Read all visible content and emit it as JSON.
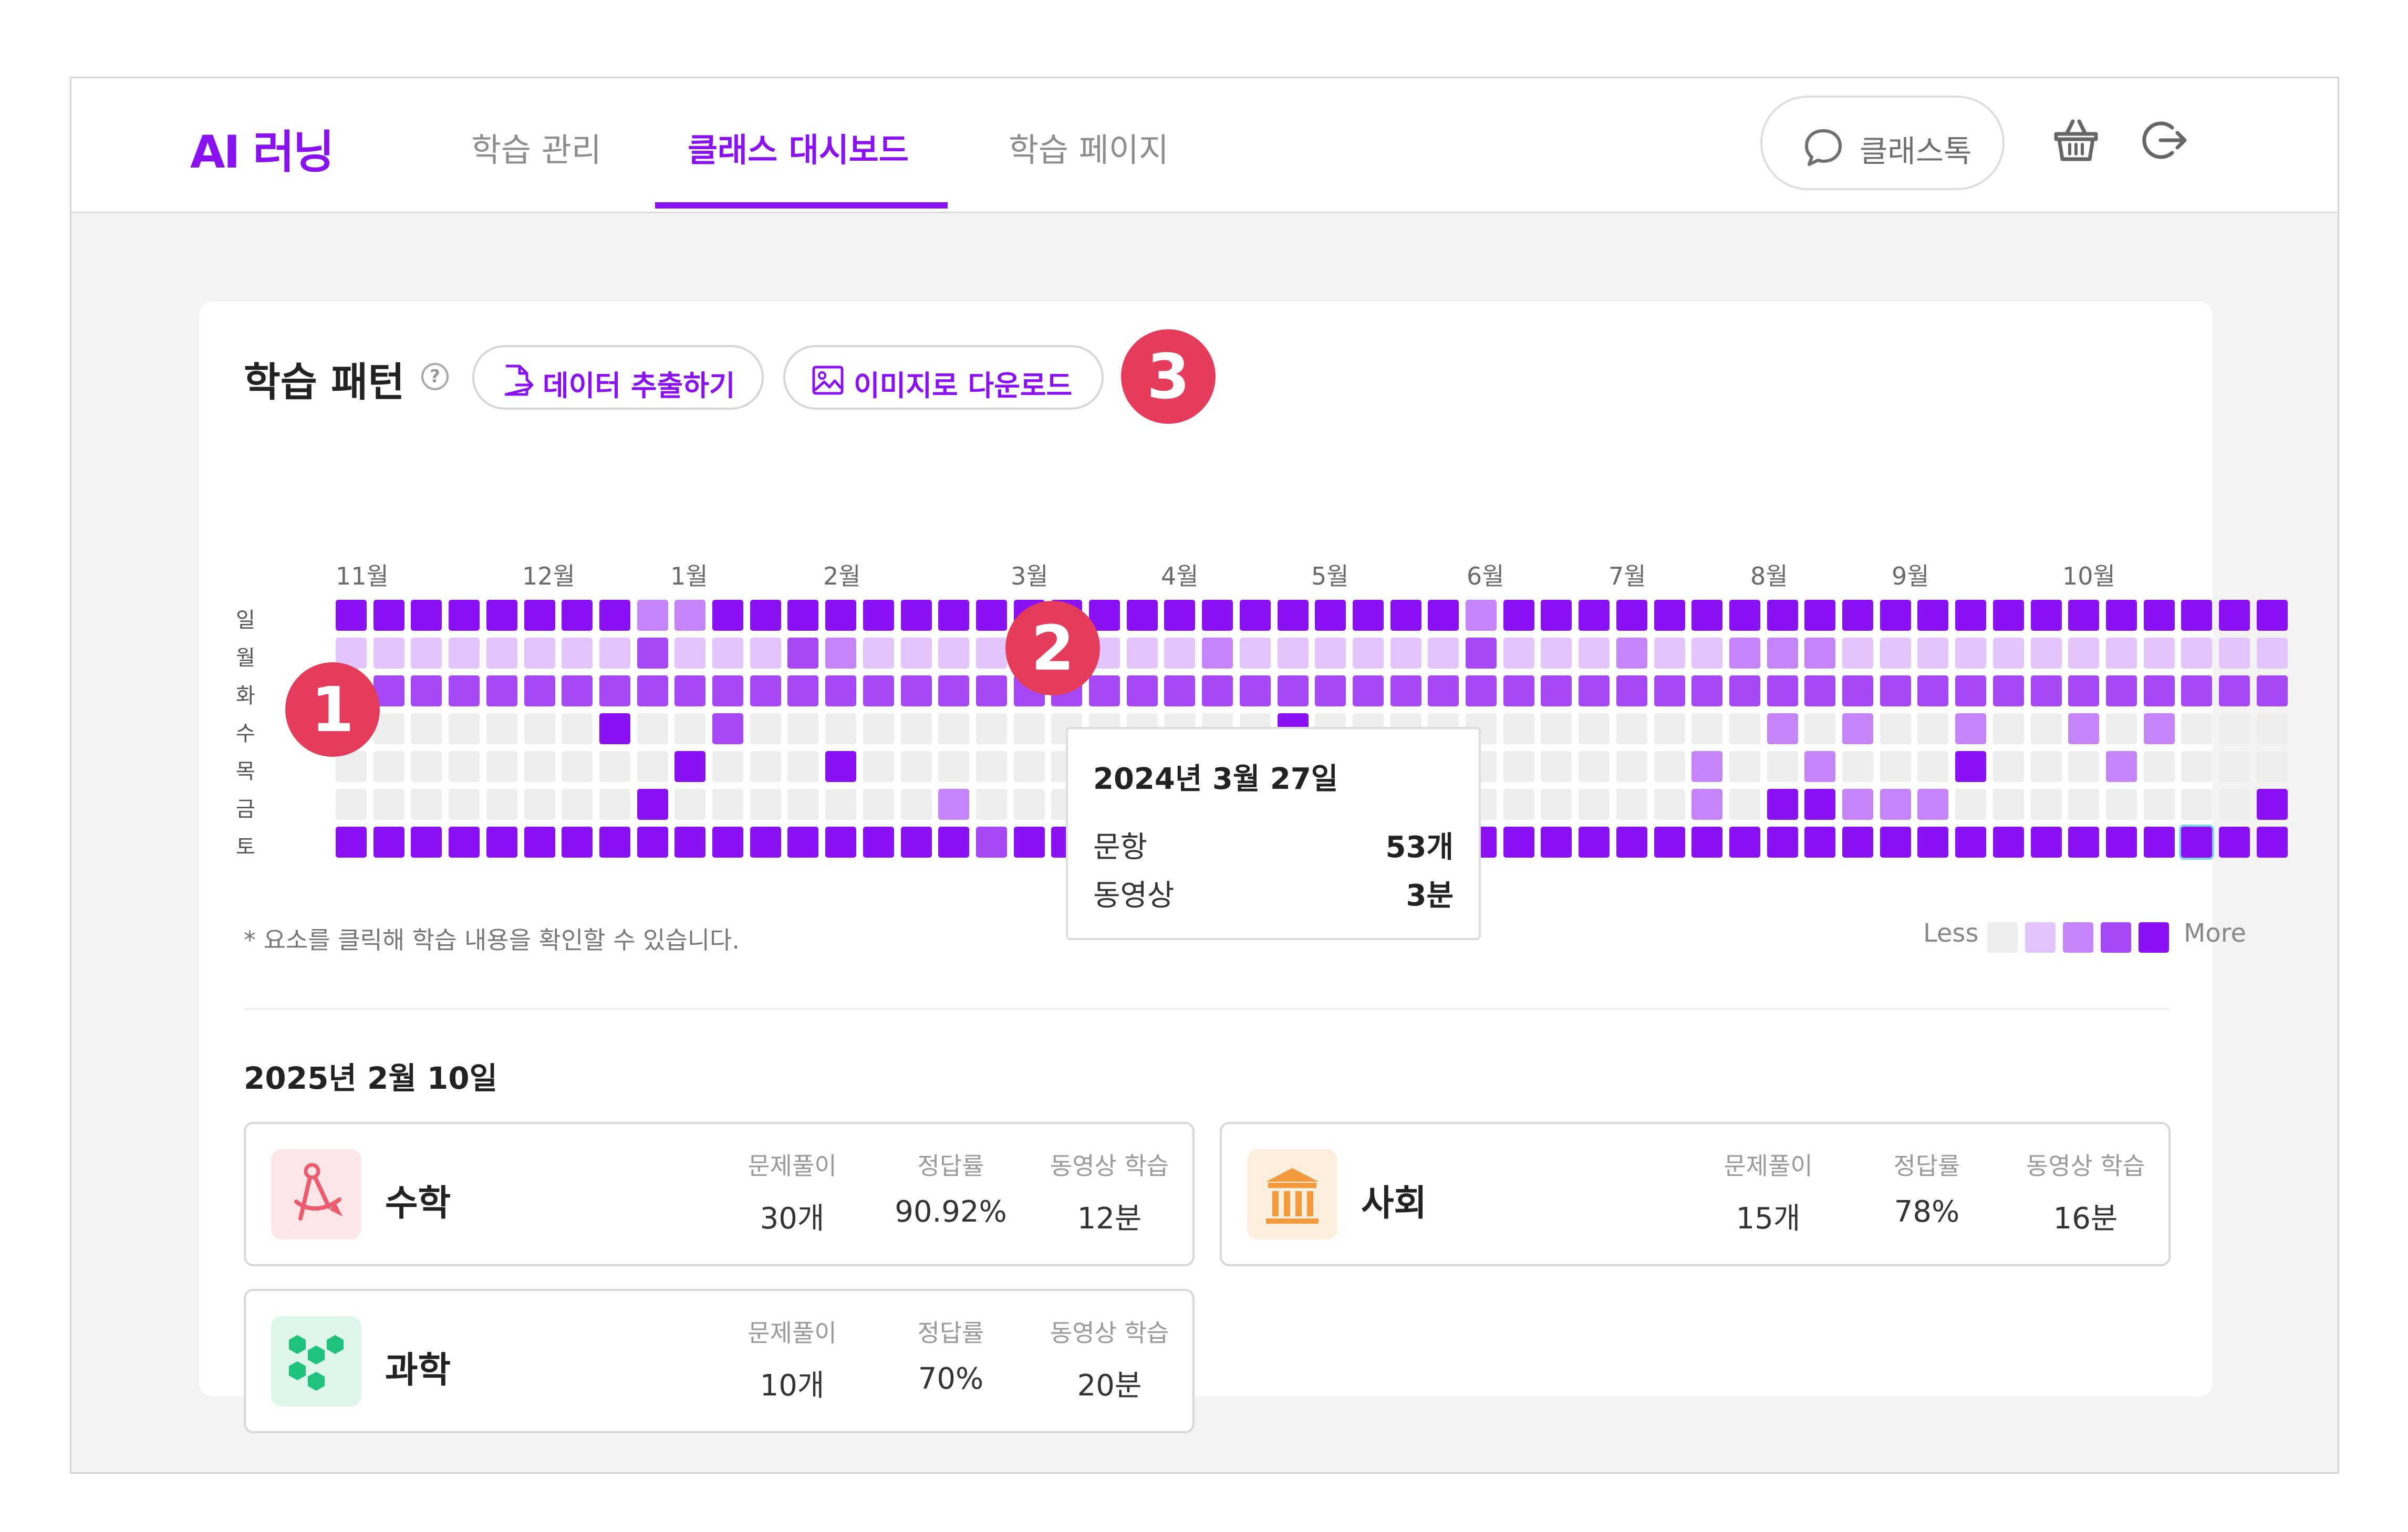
{
  "header": {
    "logo": "AI 러닝",
    "tabs": [
      {
        "label": "학습 관리",
        "active": false
      },
      {
        "label": "클래스 대시보드",
        "active": true
      },
      {
        "label": "학습 페이지",
        "active": false
      }
    ],
    "chat_label": "클래스톡"
  },
  "colors": {
    "accent": "#8a12f2",
    "badge": "#e43c5a",
    "levels": [
      "#eeeeee",
      "#e3c4fc",
      "#c585f8",
      "#a648f6",
      "#8a12f2"
    ]
  },
  "panel": {
    "title": "학습 패턴",
    "help_icon": "question-circle-icon",
    "export_label": "데이터 추출하기",
    "download_label": "이미지로 다운로드",
    "badges": [
      "1",
      "2",
      "3"
    ],
    "months": [
      "11월",
      "12월",
      "1월",
      "2월",
      "3월",
      "4월",
      "5월",
      "6월",
      "7월",
      "8월",
      "9월",
      "10월"
    ],
    "weekdays": [
      "일",
      "월",
      "화",
      "수",
      "목",
      "금",
      "토"
    ],
    "heatmap_rows": [
      "4444444422444444444444444444442444444444444444444444",
      "1111111131113211111211121111113111211222111111111111",
      "3333333333333333333333333333333333333333333333333333",
      "0000000400300000000000000400000000000020200200202000",
      "0000000004000400000000000000000000002002000400020000",
      "0000000040000000200000000000000000002044222000000004",
      "4444444444444444434444444444444444444444444444444444"
    ],
    "selected_cell": "6,49",
    "tooltip": {
      "date": "2024년 3월 27일",
      "rows": [
        {
          "label": "문항",
          "value": "53개"
        },
        {
          "label": "동영상",
          "value": "3분"
        }
      ]
    },
    "note": "* 요소를 클릭해 학습 내용을 확인할 수 있습니다.",
    "legend_less": "Less",
    "legend_more": "More"
  },
  "selected_date": "2025년 2월 10일",
  "subjects": [
    {
      "name": "수학",
      "icon": "compass-icon",
      "stats": [
        {
          "label": "문제풀이",
          "value": "30개"
        },
        {
          "label": "정답률",
          "value": "90.92%"
        },
        {
          "label": "동영상 학습",
          "value": "12분"
        }
      ]
    },
    {
      "name": "사회",
      "icon": "museum-icon",
      "stats": [
        {
          "label": "문제풀이",
          "value": "15개"
        },
        {
          "label": "정답률",
          "value": "78%"
        },
        {
          "label": "동영상 학습",
          "value": "16분"
        }
      ]
    },
    {
      "name": "과학",
      "icon": "hexagons-icon",
      "stats": [
        {
          "label": "문제풀이",
          "value": "10개"
        },
        {
          "label": "정답률",
          "value": "70%"
        },
        {
          "label": "동영상 학습",
          "value": "20분"
        }
      ]
    }
  ]
}
